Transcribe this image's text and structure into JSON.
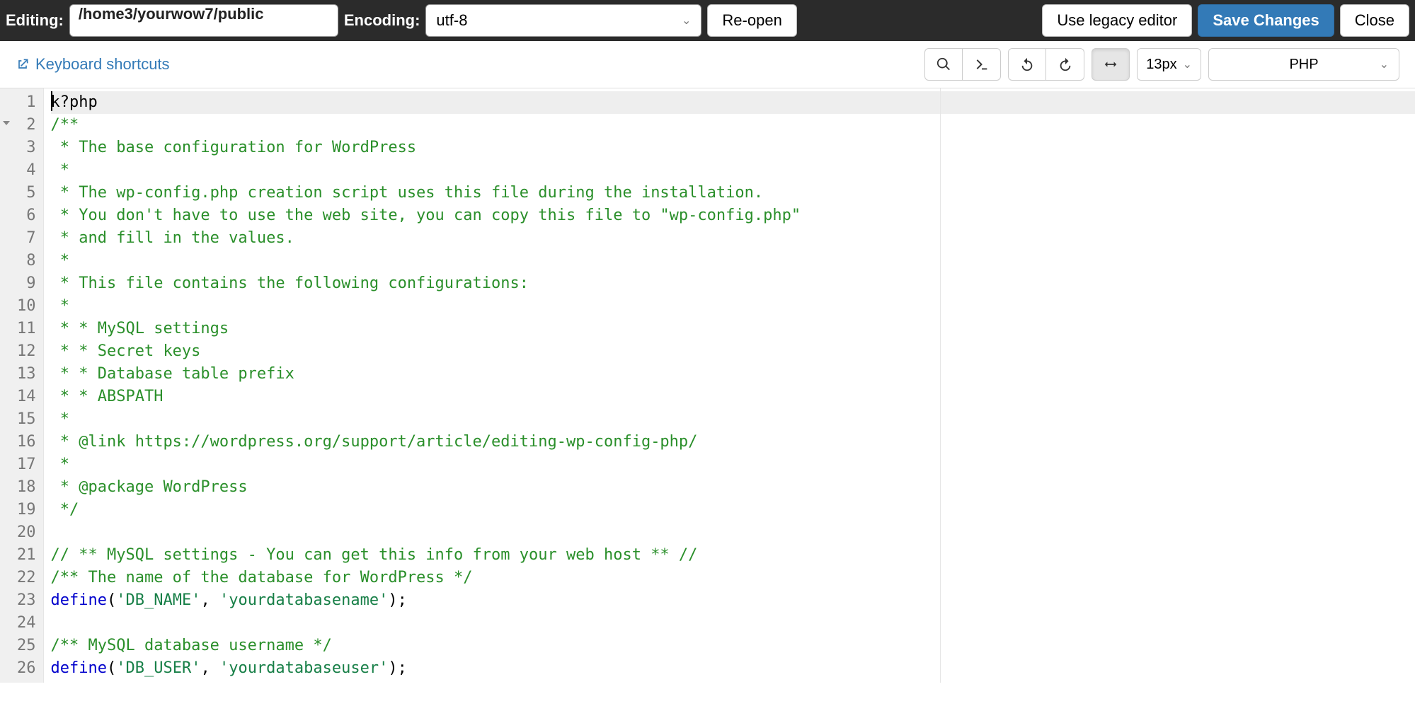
{
  "topbar": {
    "editing_label": "Editing:",
    "editing_value": "/home3/yourwow7/public",
    "encoding_label": "Encoding:",
    "encoding_value": "utf-8",
    "reopen": "Re-open",
    "legacy": "Use legacy editor",
    "save": "Save Changes",
    "close": "Close"
  },
  "toolbar": {
    "kbd_shortcuts": "Keyboard shortcuts",
    "font_size": "13px",
    "language": "PHP"
  },
  "editor": {
    "lines": [
      {
        "n": 1,
        "cls": "cur",
        "html": "k?php"
      },
      {
        "n": 2,
        "fold": true,
        "html": "<span class='c-comment'>/**</span>"
      },
      {
        "n": 3,
        "html": "<span class='c-comment'> * The base configuration for WordPress</span>"
      },
      {
        "n": 4,
        "html": "<span class='c-comment'> *</span>"
      },
      {
        "n": 5,
        "html": "<span class='c-comment'> * The wp-config.php creation script uses this file during the installation.</span>"
      },
      {
        "n": 6,
        "html": "<span class='c-comment'> * You don't have to use the web site, you can copy this file to \"wp-config.php\"</span>"
      },
      {
        "n": 7,
        "html": "<span class='c-comment'> * and fill in the values.</span>"
      },
      {
        "n": 8,
        "html": "<span class='c-comment'> *</span>"
      },
      {
        "n": 9,
        "html": "<span class='c-comment'> * This file contains the following configurations:</span>"
      },
      {
        "n": 10,
        "html": "<span class='c-comment'> *</span>"
      },
      {
        "n": 11,
        "html": "<span class='c-comment'> * * MySQL settings</span>"
      },
      {
        "n": 12,
        "html": "<span class='c-comment'> * * Secret keys</span>"
      },
      {
        "n": 13,
        "html": "<span class='c-comment'> * * Database table prefix</span>"
      },
      {
        "n": 14,
        "html": "<span class='c-comment'> * * ABSPATH</span>"
      },
      {
        "n": 15,
        "html": "<span class='c-comment'> *</span>"
      },
      {
        "n": 16,
        "html": "<span class='c-comment'> * @link https://wordpress.org/support/article/editing-wp-config-php/</span>"
      },
      {
        "n": 17,
        "html": "<span class='c-comment'> *</span>"
      },
      {
        "n": 18,
        "html": "<span class='c-comment'> * @package WordPress</span>"
      },
      {
        "n": 19,
        "html": "<span class='c-comment'> */</span>"
      },
      {
        "n": 20,
        "html": ""
      },
      {
        "n": 21,
        "html": "<span class='c-comment'>// ** MySQL settings - You can get this info from your web host ** //</span>"
      },
      {
        "n": 22,
        "html": "<span class='c-comment'>/** The name of the database for WordPress */</span>"
      },
      {
        "n": 23,
        "html": "<span class='c-key'>define</span>(<span class='c-str2'>'DB_NAME'</span>, <span class='c-str2'>'yourdatabasename'</span>);"
      },
      {
        "n": 24,
        "html": ""
      },
      {
        "n": 25,
        "html": "<span class='c-comment'>/** MySQL database username */</span>"
      },
      {
        "n": 26,
        "html": "<span class='c-key'>define</span>(<span class='c-str2'>'DB_USER'</span>, <span class='c-str2'>'yourdatabaseuser'</span>);"
      }
    ]
  }
}
